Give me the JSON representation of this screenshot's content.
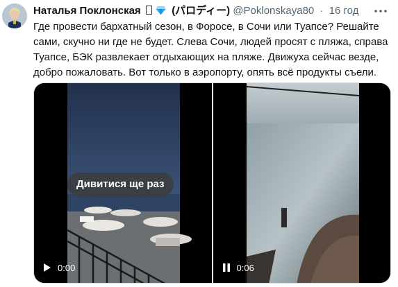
{
  "tweet": {
    "display_name": "Наталья Поклонская",
    "name_suffix": "(パロディー)",
    "handle": "@Poklonskaya80",
    "separator": "·",
    "time": "16 год",
    "text": "Где провести бархатный сезон, в Форосе, в Сочи или Туапсе? Решайте сами, скучно ни где не будет. Слева Сочи, людей просят с пляжа, справа Туапсе, БЭК развлекает отдыхающих на пляже. Движуха сейчас везде, добро пожаловать. Вот только в аэропорту, опять всё продукты съели."
  },
  "icons": {
    "avatar": "avatar-image",
    "badge": "blue-diamond-icon",
    "more": "more-dots-icon",
    "play": "play-icon",
    "pause": "pause-icon"
  },
  "media": {
    "video_left": {
      "replay_label": "Дивитися ще раз",
      "control": "play",
      "time": "0:00"
    },
    "video_right": {
      "control": "pause",
      "time": "0:06"
    }
  },
  "colors": {
    "text": "#0f1419",
    "secondary": "#536471",
    "diamond": "#29a8ff",
    "border": "#cfd9de"
  }
}
